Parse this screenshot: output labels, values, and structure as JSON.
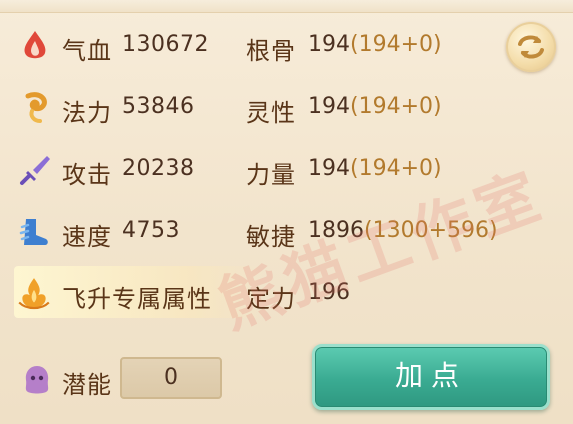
{
  "stats": [
    {
      "icon": "blood-drop-icon",
      "label": "气血",
      "value": "130672",
      "attr_label": "根骨",
      "attr_value": "194",
      "attr_detail": "(194+0)"
    },
    {
      "icon": "mana-swirl-icon",
      "label": "法力",
      "value": "53846",
      "attr_label": "灵性",
      "attr_value": "194",
      "attr_detail": "(194+0)"
    },
    {
      "icon": "sword-icon",
      "label": "攻击",
      "value": "20238",
      "attr_label": "力量",
      "attr_value": "194",
      "attr_detail": "(194+0)"
    },
    {
      "icon": "boot-wing-icon",
      "label": "速度",
      "value": "4753",
      "attr_label": "敏捷",
      "attr_value": "1896",
      "attr_detail": "(1300+596)"
    }
  ],
  "ascend": {
    "label": "飞升专属属性",
    "attr_label": "定力",
    "attr_value": "196"
  },
  "potential": {
    "label": "潜能",
    "value": "0"
  },
  "add_button": {
    "label": "加点"
  },
  "watermark": "熊猫工作室",
  "colors": {
    "button": "#3aab92",
    "text": "#5a3518",
    "detail": "#b27a2d"
  }
}
